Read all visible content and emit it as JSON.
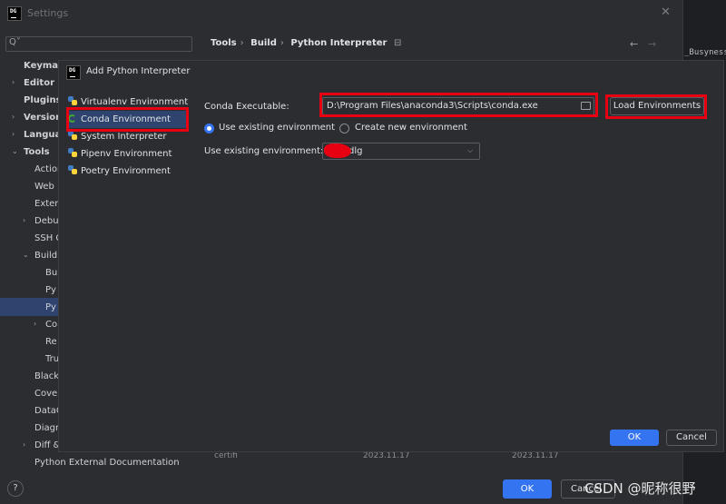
{
  "settings": {
    "title": "Settings",
    "logo": "DG",
    "breadcrumb": [
      "Tools",
      "Build",
      "Python Interpreter"
    ],
    "sidebar": [
      {
        "label": "Keymap",
        "bold": true
      },
      {
        "label": "Editor",
        "bold": true
      },
      {
        "label": "Plugins",
        "bold": true
      },
      {
        "label": "Version",
        "bold": true
      },
      {
        "label": "Languag",
        "bold": true
      },
      {
        "label": "Tools",
        "bold": true
      },
      {
        "label": "Action",
        "bold": false
      },
      {
        "label": "Web I",
        "bold": false
      },
      {
        "label": "Exter",
        "bold": false
      },
      {
        "label": "Debu",
        "bold": false
      },
      {
        "label": "SSH C",
        "bold": false
      },
      {
        "label": "Build",
        "bold": false
      },
      {
        "label": "Bu",
        "bold": false
      },
      {
        "label": "Py",
        "bold": false
      },
      {
        "label": "Py",
        "bold": false
      },
      {
        "label": "Co",
        "bold": false
      },
      {
        "label": "Re",
        "bold": false
      },
      {
        "label": "Tru",
        "bold": false
      },
      {
        "label": "Black",
        "bold": false
      },
      {
        "label": "Cover",
        "bold": false
      },
      {
        "label": "DataC",
        "bold": false
      },
      {
        "label": "Diagr",
        "bold": false
      },
      {
        "label": "Diff &",
        "bold": false
      },
      {
        "label": "Python External Documentation",
        "bold": false
      }
    ],
    "ok_label": "OK",
    "cancel_label": "Cancel",
    "help_label": "?",
    "table_fragment": {
      "name": "certifi",
      "date1": "2023.11.17",
      "date2": "2023.11.17"
    }
  },
  "editor_fragment": {
    "text": "_Busyness"
  },
  "dialog": {
    "title": "Add Python Interpreter",
    "environments": [
      {
        "label": "Virtualenv Environment",
        "icon": "python-icon"
      },
      {
        "label": "Conda Environment",
        "icon": "conda-icon",
        "selected": true
      },
      {
        "label": "System Interpreter",
        "icon": "python-icon"
      },
      {
        "label": "Pipenv Environment",
        "icon": "python-icon"
      },
      {
        "label": "Poetry Environment",
        "icon": "python-icon"
      }
    ],
    "conda_executable_label": "Conda Executable:",
    "conda_executable_value": "D:\\Program Files\\anaconda3\\Scripts\\conda.exe",
    "load_environments_label": "Load Environments",
    "radio_existing_label": "Use existing environment",
    "radio_new_label": "Create new environment",
    "existing_env_label": "Use existing environment:",
    "existing_env_value": "dlg",
    "ok_label": "OK",
    "cancel_label": "Cancel"
  },
  "watermark": "CSDN @昵称很野",
  "colors": {
    "accent": "#3574f0",
    "annotation_red": "#e60012",
    "selection": "#2e436e"
  }
}
